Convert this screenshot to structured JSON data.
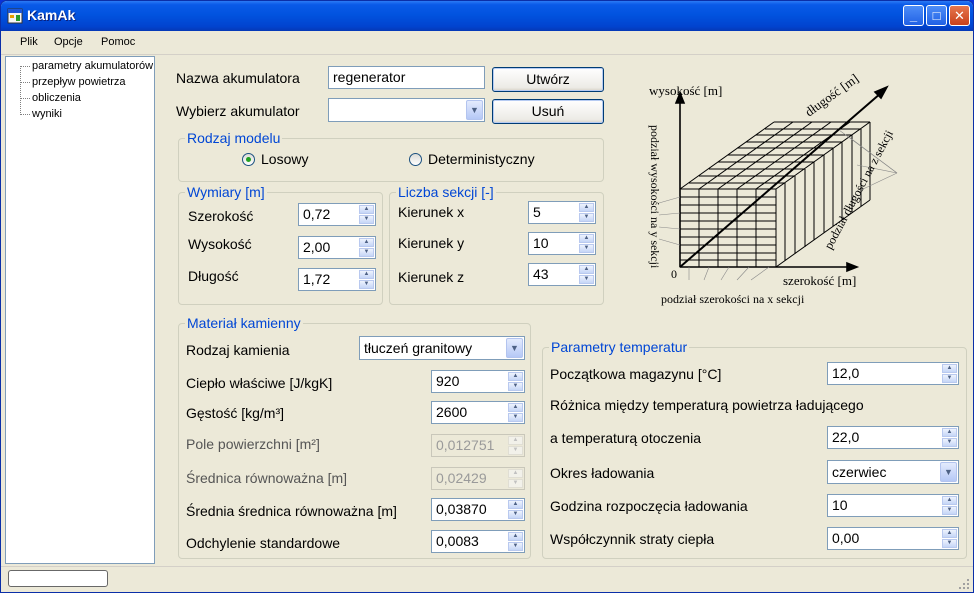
{
  "window": {
    "title": "KamAk",
    "icon": "app-window-icon"
  },
  "titlebar_buttons": {
    "minimize": "minimize-icon",
    "maximize": "maximize-icon",
    "close": "close-icon"
  },
  "menu": [
    "Plik",
    "Opcje",
    "Pomoc"
  ],
  "tree": [
    "parametry akumulatorów",
    "przepływ powietrza",
    "obliczenia",
    "wyniki"
  ],
  "top": {
    "name_label": "Nazwa akumulatora",
    "name_value": "regenerator",
    "create_button": "Utwórz",
    "select_label": "Wybierz akumulator",
    "select_value": "",
    "delete_button": "Usuń"
  },
  "model": {
    "title": "Rodzaj modelu",
    "options": [
      "Losowy",
      "Deterministyczny"
    ],
    "selected": "Losowy"
  },
  "dimensions": {
    "title": "Wymiary [m]",
    "fields": [
      {
        "label": "Szerokość",
        "value": "0,72"
      },
      {
        "label": "Wysokość",
        "value": "2,00"
      },
      {
        "label": "Długość",
        "value": "1,72"
      }
    ]
  },
  "sections": {
    "title": "Liczba sekcji [-]",
    "fields": [
      {
        "label": "Kierunek x",
        "value": "5"
      },
      {
        "label": "Kierunek y",
        "value": "10"
      },
      {
        "label": "Kierunek z",
        "value": "43"
      }
    ]
  },
  "material": {
    "title": "Materiał kamienny",
    "type_label": "Rodzaj kamienia",
    "type_value": "tłuczeń granitowy",
    "fields": [
      {
        "label": "Ciepło właściwe [J/kgK]",
        "value": "920",
        "enabled": true
      },
      {
        "label": "Gęstość [kg/m³]",
        "value": "2600",
        "enabled": true
      },
      {
        "label": "Pole powierzchni [m²]",
        "value": "0,012751",
        "enabled": false
      },
      {
        "label": "Średnica równoważna [m]",
        "value": "0,02429",
        "enabled": false
      },
      {
        "label": "Średnia średnica równoważna [m]",
        "value": "0,03870",
        "enabled": true
      },
      {
        "label": "Odchylenie standardowe",
        "value": "0,0083",
        "enabled": true
      }
    ]
  },
  "temperature": {
    "title": "Parametry temperatur",
    "initial_label": "Początkowa magazynu [°C]",
    "initial_value": "12,0",
    "diff_label_1": "Różnica między temperaturą powietrza ładującego",
    "diff_label_2": "a temperaturą otoczenia",
    "diff_value": "22,0",
    "period_label": "Okres ładowania",
    "period_value": "czerwiec",
    "hour_label": "Godzina rozpoczęcia ładowania",
    "hour_value": "10",
    "loss_label": "Współczynnik straty ciepła",
    "loss_value": "0,00"
  },
  "diagram": {
    "height_label": "wysokość [m]",
    "length_label": "długość [m]",
    "width_label": "szerokość [m]",
    "origin_label": "0",
    "y_sections_label": "podział wysokości na y sekcji",
    "z_sections_label": "podział długości na z sekcji",
    "x_sections_label": "podział szerokości na x sekcji"
  }
}
